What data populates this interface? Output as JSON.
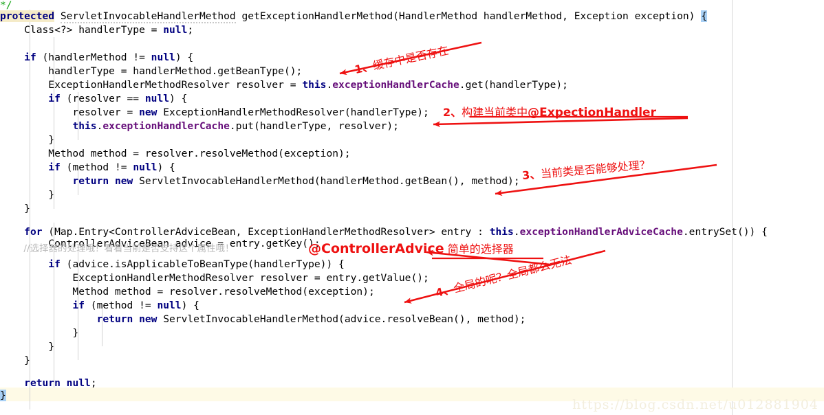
{
  "editor": {
    "background": "#ffffff",
    "keyword_color": "#000080",
    "field_color": "#660e7a",
    "comment_color": "#12a312",
    "line_comment_color": "#b9b9b9",
    "highlight_line_color": "#fefae6",
    "brace_match_color": "#a8d0f5",
    "keyword_highlight_color": "#f5ebc8",
    "lines": [
      {
        "id": "line-0",
        "indent": 5,
        "text": "*/"
      },
      {
        "id": "line-1",
        "indent": 0,
        "text": "protected ServletInvocableHandlerMethod getExceptionHandlerMethod(HandlerMethod handlerMethod, Exception exception) {"
      },
      {
        "id": "line-2",
        "indent": 4,
        "text": "Class<?> handlerType = null;"
      },
      {
        "id": "line-3",
        "indent": 0,
        "text": ""
      },
      {
        "id": "line-4",
        "indent": 4,
        "text": "if (handlerMethod != null) {"
      },
      {
        "id": "line-5",
        "indent": 8,
        "text": "handlerType = handlerMethod.getBeanType();"
      },
      {
        "id": "line-6",
        "indent": 8,
        "text": "ExceptionHandlerMethodResolver resolver = this.exceptionHandlerCache.get(handlerType);"
      },
      {
        "id": "line-7",
        "indent": 8,
        "text": "if (resolver == null) {"
      },
      {
        "id": "line-8",
        "indent": 12,
        "text": "resolver = new ExceptionHandlerMethodResolver(handlerType);"
      },
      {
        "id": "line-9",
        "indent": 12,
        "text": "this.exceptionHandlerCache.put(handlerType, resolver);"
      },
      {
        "id": "line-10",
        "indent": 8,
        "text": "}"
      },
      {
        "id": "line-11",
        "indent": 8,
        "text": "Method method = resolver.resolveMethod(exception);"
      },
      {
        "id": "line-12",
        "indent": 8,
        "text": "if (method != null) {"
      },
      {
        "id": "line-13",
        "indent": 12,
        "text": "return new ServletInvocableHandlerMethod(handlerMethod.getBean(), method);"
      },
      {
        "id": "line-14",
        "indent": 8,
        "text": "}"
      },
      {
        "id": "line-15",
        "indent": 4,
        "text": "}"
      },
      {
        "id": "line-16",
        "indent": 0,
        "text": ""
      },
      {
        "id": "line-17",
        "indent": 4,
        "text": "for (Map.Entry<ControllerAdviceBean, ExceptionHandlerMethodResolver> entry : this.exceptionHandlerAdviceCache.entrySet()) {"
      },
      {
        "id": "line-18",
        "indent": 8,
        "text": "ControllerAdviceBean advice = entry.getKey();"
      },
      {
        "id": "line-19",
        "indent": 8,
        "text": "//选择器的处理哦！看看当前是否支持这个属性哦！"
      },
      {
        "id": "line-20",
        "indent": 8,
        "text": "if (advice.isApplicableToBeanType(handlerType)) {"
      },
      {
        "id": "line-21",
        "indent": 12,
        "text": "ExceptionHandlerMethodResolver resolver = entry.getValue();"
      },
      {
        "id": "line-22",
        "indent": 12,
        "text": "Method method = resolver.resolveMethod(exception);"
      },
      {
        "id": "line-23",
        "indent": 12,
        "text": "if (method != null) {"
      },
      {
        "id": "line-24",
        "indent": 16,
        "text": "return new ServletInvocableHandlerMethod(advice.resolveBean(), method);"
      },
      {
        "id": "line-25",
        "indent": 12,
        "text": "}"
      },
      {
        "id": "line-26",
        "indent": 8,
        "text": "}"
      },
      {
        "id": "line-27",
        "indent": 4,
        "text": "}"
      },
      {
        "id": "line-28",
        "indent": 0,
        "text": ""
      },
      {
        "id": "line-29",
        "indent": 4,
        "text": "return null;"
      },
      {
        "id": "line-30",
        "indent": 0,
        "text": "}"
      }
    ]
  },
  "annotations": {
    "color": "#ee1111",
    "items": [
      {
        "id": "anno-1",
        "number": "1、",
        "cn": "缓存中是否存在",
        "en": ""
      },
      {
        "id": "anno-2",
        "number": "2、",
        "cn": "构建当前类中",
        "en": "@ExpectionHandler"
      },
      {
        "id": "anno-3",
        "number": "3、",
        "cn": "当前类是否能够处理？",
        "en": ""
      },
      {
        "id": "anno-4",
        "number": "4、",
        "cn": "全局的呢？全局都么无法",
        "en": ""
      },
      {
        "id": "anno-5",
        "number": "",
        "cn": "简单的选择器",
        "en": "@ControllerAdvice"
      }
    ]
  },
  "watermark": {
    "text": "https://blog.csdn.net/u012881904",
    "color": "#f3eedd"
  }
}
